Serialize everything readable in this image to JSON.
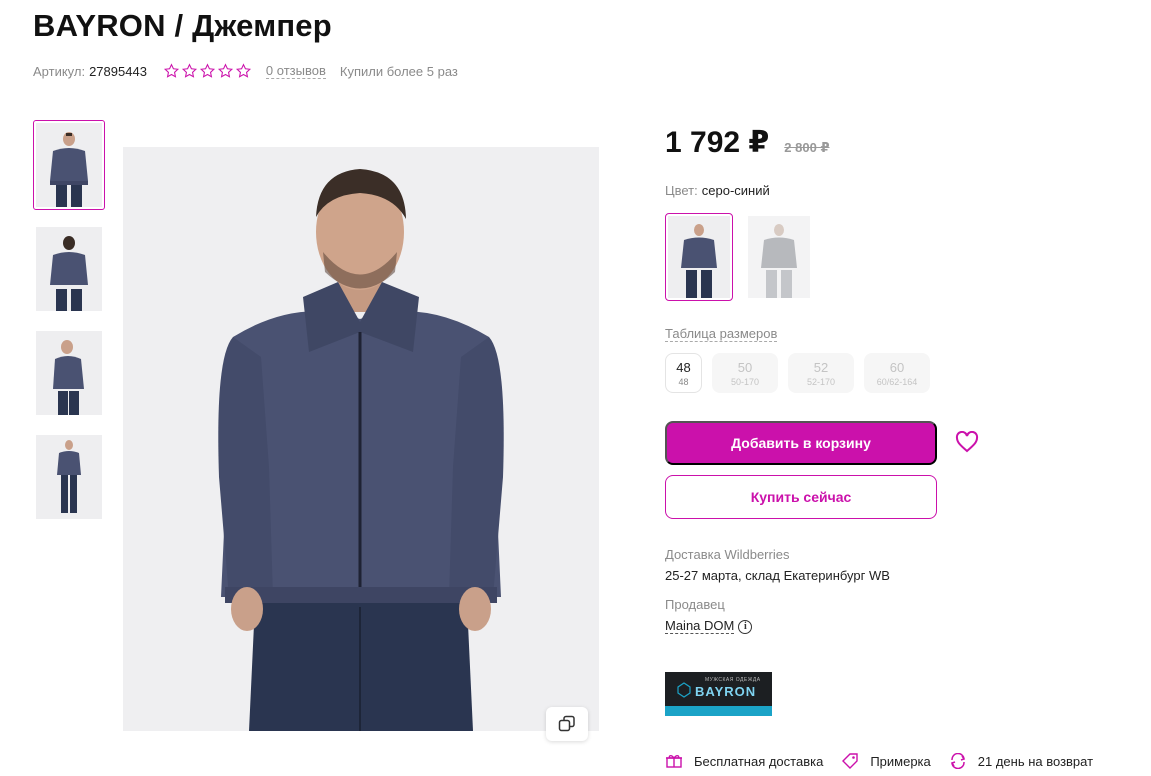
{
  "product": {
    "title": "BAYRON / Джемпер",
    "article_label": "Артикул:",
    "article_value": "27895443",
    "rating_stars": 0,
    "reviews_label": "0 отзывов",
    "bought_label": "Купили более 5 раз"
  },
  "price": {
    "current": "1 792 ₽",
    "old": "2 800 ₽"
  },
  "color": {
    "label": "Цвет:",
    "value": "серо-синий"
  },
  "sizes": {
    "table_label": "Таблица размеров",
    "items": [
      {
        "num": "48",
        "sub": "48",
        "available": true
      },
      {
        "num": "50",
        "sub": "50-170",
        "available": false
      },
      {
        "num": "52",
        "sub": "52-170",
        "available": false
      },
      {
        "num": "60",
        "sub": "60/62-164",
        "available": false
      }
    ]
  },
  "actions": {
    "add_to_cart": "Добавить в корзину",
    "buy_now": "Купить сейчас"
  },
  "delivery": {
    "label": "Доставка Wildberries",
    "value": "25-27 марта, склад Екатеринбург WB"
  },
  "seller": {
    "label": "Продавец",
    "name": "Maina DOM"
  },
  "brand_banner": {
    "small_text": "МУЖСКАЯ ОДЕЖДА",
    "name": "BAYRON"
  },
  "features": [
    {
      "icon": "free-delivery-icon",
      "label": "Бесплатная доставка"
    },
    {
      "icon": "tag-icon",
      "label": "Примерка"
    },
    {
      "icon": "return-icon",
      "label": "21 день на возврат"
    }
  ],
  "colors": {
    "accent": "#cb11ab",
    "jacket": "#4a5272",
    "jeans": "#2a3550"
  }
}
